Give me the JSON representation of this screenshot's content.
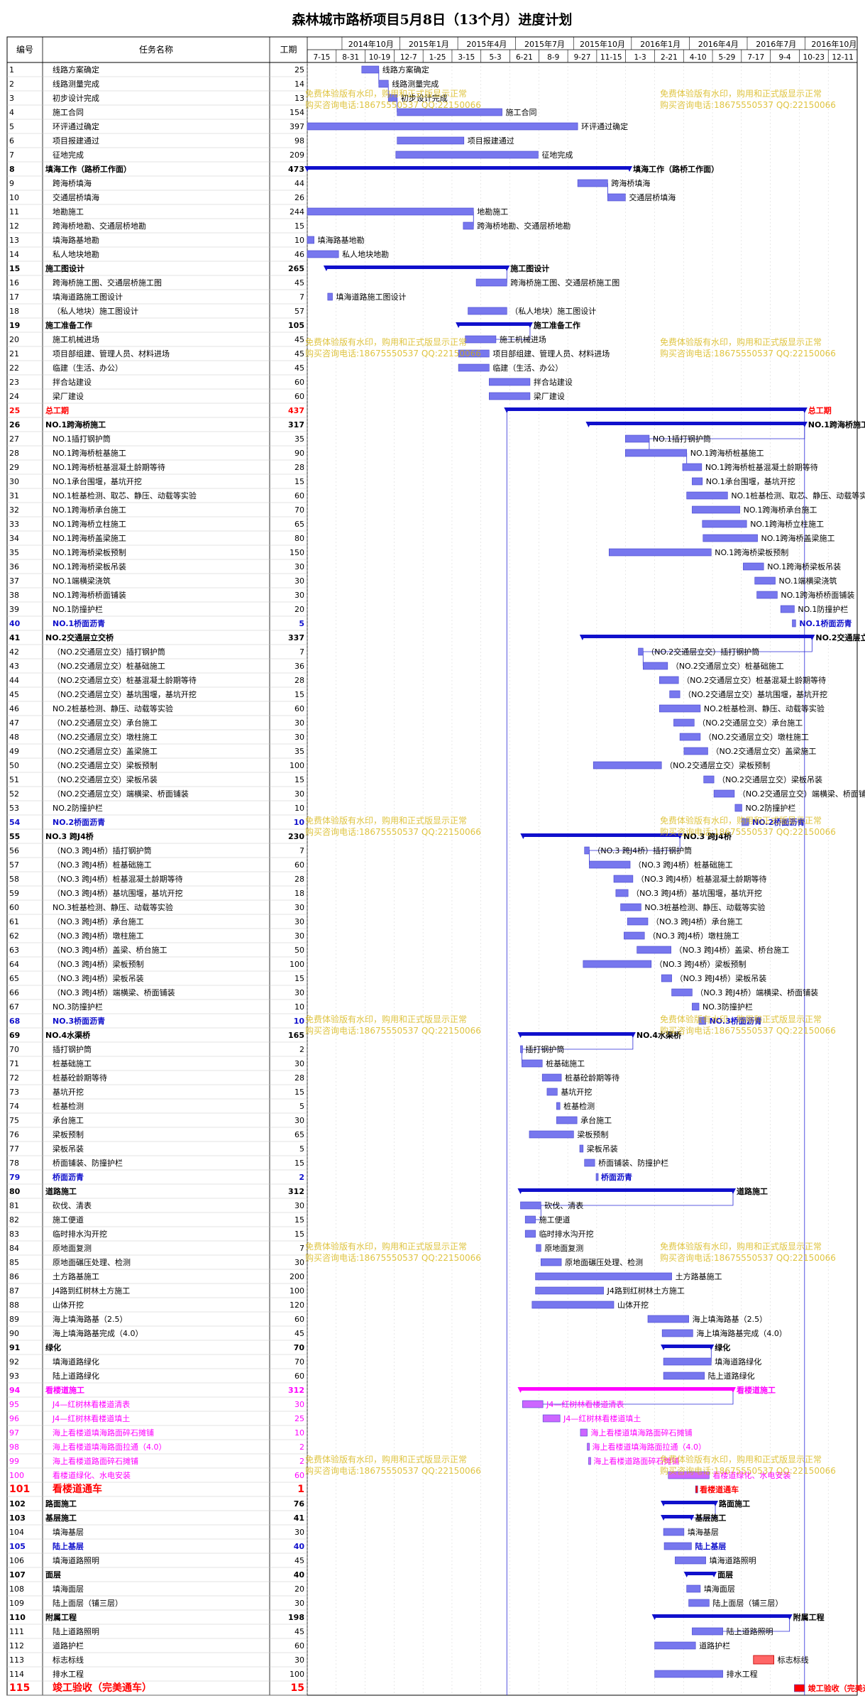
{
  "title": "森林城市路桥项目5月8日（13个月）进度计划",
  "columns": {
    "id": "编号",
    "name": "任务名称",
    "duration": "工期"
  },
  "timeline": {
    "top_labels": [
      "2014年10月",
      "2015年1月",
      "2015年4月",
      "2015年7月",
      "2015年10月",
      "2016年1月",
      "2016年4月",
      "2016年7月",
      "2016年10月"
    ],
    "bottom_labels": [
      "7-15",
      "8-31",
      "10-19",
      "12-7",
      "1-25",
      "3-15",
      "5-3",
      "6-21",
      "8-9",
      "9-27",
      "11-15",
      "1-3",
      "2-21",
      "4-10",
      "5-29",
      "7-17",
      "9-4",
      "10-23",
      "12-11"
    ]
  },
  "watermark": {
    "line1": "免费体验版有水印，购用和正式版显示正常",
    "line2": "购买咨询电话:18675550537  QQ:22150066"
  },
  "colors": {
    "bar": "#7777ee",
    "bar_dark": "#4444cc",
    "summary": "#1010cc",
    "link": "#2a2ad8",
    "red": "#ff0000",
    "magenta": "#ff00ff",
    "grid": "#c8c8c8"
  },
  "chart_data": {
    "type": "gantt",
    "x_unit": "days from 2014-07-15",
    "tasks": [
      {
        "id": "1",
        "name": "线路方案确定",
        "duration": 25,
        "start": 80,
        "kind": "task",
        "style": "normal"
      },
      {
        "id": "2",
        "name": "线路测量完成",
        "duration": 14,
        "start": 105,
        "kind": "task",
        "style": "normal"
      },
      {
        "id": "3",
        "name": "初步设计完成",
        "duration": 13,
        "start": 119,
        "kind": "task",
        "style": "normal"
      },
      {
        "id": "4",
        "name": "施工合同",
        "duration": 154,
        "start": 132,
        "kind": "task",
        "style": "normal"
      },
      {
        "id": "5",
        "name": "环评通过确定",
        "duration": 397,
        "start": 0,
        "kind": "task",
        "style": "normal"
      },
      {
        "id": "6",
        "name": "项目报建通过",
        "duration": 98,
        "start": 132,
        "kind": "task",
        "style": "normal"
      },
      {
        "id": "7",
        "name": "征地完成",
        "duration": 209,
        "start": 130,
        "kind": "task",
        "style": "normal"
      },
      {
        "id": "8",
        "name": "填海工作（路桥工作面）",
        "duration": 473,
        "start": 0,
        "kind": "summary",
        "style": "normal"
      },
      {
        "id": "9",
        "name": "跨海桥填海",
        "duration": 44,
        "start": 397,
        "kind": "task",
        "style": "normal"
      },
      {
        "id": "10",
        "name": "交通层桥填海",
        "duration": 26,
        "start": 441,
        "kind": "task",
        "style": "normal"
      },
      {
        "id": "11",
        "name": "地勘施工",
        "duration": 244,
        "start": 0,
        "kind": "task",
        "style": "normal"
      },
      {
        "id": "12",
        "name": "跨海桥地勘、交通层桥地勘",
        "duration": 15,
        "start": 229,
        "kind": "task",
        "style": "normal"
      },
      {
        "id": "13",
        "name": "填海路基地勘",
        "duration": 10,
        "start": 0,
        "kind": "task",
        "style": "normal"
      },
      {
        "id": "14",
        "name": "私人地块地勘",
        "duration": 46,
        "start": 0,
        "kind": "task",
        "style": "normal"
      },
      {
        "id": "15",
        "name": "施工图设计",
        "duration": 265,
        "start": 28,
        "kind": "summary",
        "style": "normal"
      },
      {
        "id": "16",
        "name": "跨海桥施工图、交通层桥施工图",
        "duration": 45,
        "start": 248,
        "kind": "task",
        "style": "normal"
      },
      {
        "id": "17",
        "name": "填海道路施工图设计",
        "duration": 7,
        "start": 30,
        "kind": "task",
        "style": "normal"
      },
      {
        "id": "18",
        "name": "（私人地块）施工图设计",
        "duration": 57,
        "start": 236,
        "kind": "task",
        "style": "normal"
      },
      {
        "id": "19",
        "name": "施工准备工作",
        "duration": 105,
        "start": 222,
        "kind": "summary",
        "style": "normal"
      },
      {
        "id": "20",
        "name": "施工机械进场",
        "duration": 45,
        "start": 232,
        "kind": "task",
        "style": "normal"
      },
      {
        "id": "21",
        "name": "项目部组建、管理人员、材料进场",
        "duration": 45,
        "start": 222,
        "kind": "task",
        "style": "normal"
      },
      {
        "id": "22",
        "name": "临建（生活、办公）",
        "duration": 45,
        "start": 222,
        "kind": "task",
        "style": "normal"
      },
      {
        "id": "23",
        "name": "拌合站建设",
        "duration": 60,
        "start": 267,
        "kind": "task",
        "style": "normal"
      },
      {
        "id": "24",
        "name": "梁厂建设",
        "duration": 60,
        "start": 267,
        "kind": "task",
        "style": "normal"
      },
      {
        "id": "25",
        "name": "总工期",
        "duration": 437,
        "start": 293,
        "kind": "summary",
        "style": "red"
      },
      {
        "id": "26",
        "name": "NO.1跨海桥施工",
        "duration": 317,
        "start": 413,
        "kind": "summary",
        "style": "normal"
      },
      {
        "id": "27",
        "name": "NO.1插打钢护筒",
        "duration": 35,
        "start": 467,
        "kind": "task",
        "style": "normal"
      },
      {
        "id": "28",
        "name": "NO.1跨海桥桩基施工",
        "duration": 90,
        "start": 467,
        "kind": "task",
        "style": "normal"
      },
      {
        "id": "29",
        "name": "NO.1跨海桥桩基混凝土龄期等待",
        "duration": 28,
        "start": 551,
        "kind": "task",
        "style": "normal"
      },
      {
        "id": "30",
        "name": "NO.1承台围堰，基坑开挖",
        "duration": 15,
        "start": 565,
        "kind": "task",
        "style": "normal"
      },
      {
        "id": "31",
        "name": "NO.1桩基检测、取芯、静压、动载等实验",
        "duration": 60,
        "start": 557,
        "kind": "task",
        "style": "normal"
      },
      {
        "id": "32",
        "name": "NO.1跨海桥承台施工",
        "duration": 70,
        "start": 565,
        "kind": "task",
        "style": "normal"
      },
      {
        "id": "33",
        "name": "NO.1跨海桥立柱施工",
        "duration": 65,
        "start": 580,
        "kind": "task",
        "style": "normal"
      },
      {
        "id": "34",
        "name": "NO.1跨海桥盖梁施工",
        "duration": 80,
        "start": 581,
        "kind": "task",
        "style": "normal"
      },
      {
        "id": "35",
        "name": "NO.1跨海桥梁板预制",
        "duration": 150,
        "start": 443,
        "kind": "task",
        "style": "normal"
      },
      {
        "id": "36",
        "name": "NO.1跨海桥梁板吊装",
        "duration": 30,
        "start": 640,
        "kind": "task",
        "style": "normal"
      },
      {
        "id": "37",
        "name": "NO.1端横梁浇筑",
        "duration": 30,
        "start": 657,
        "kind": "task",
        "style": "normal"
      },
      {
        "id": "38",
        "name": "NO.1跨海桥桥面铺装",
        "duration": 30,
        "start": 660,
        "kind": "task",
        "style": "normal"
      },
      {
        "id": "39",
        "name": "NO.1防撞护栏",
        "duration": 20,
        "start": 695,
        "kind": "task",
        "style": "normal"
      },
      {
        "id": "40",
        "name": "NO.1桥面沥青",
        "duration": 5,
        "start": 712,
        "kind": "task",
        "style": "blue"
      },
      {
        "id": "41",
        "name": "NO.2交通层立交桥",
        "duration": 337,
        "start": 404,
        "kind": "summary",
        "style": "normal"
      },
      {
        "id": "42",
        "name": "（NO.2交通层立交）插打钢护筒",
        "duration": 7,
        "start": 486,
        "kind": "task",
        "style": "normal"
      },
      {
        "id": "43",
        "name": "（NO.2交通层立交）桩基础施工",
        "duration": 36,
        "start": 493,
        "kind": "task",
        "style": "normal"
      },
      {
        "id": "44",
        "name": "（NO.2交通层立交）桩基混凝土龄期等待",
        "duration": 28,
        "start": 517,
        "kind": "task",
        "style": "normal"
      },
      {
        "id": "45",
        "name": "（NO.2交通层立交）基坑围堰，基坑开挖",
        "duration": 15,
        "start": 532,
        "kind": "task",
        "style": "normal"
      },
      {
        "id": "46",
        "name": "NO.2桩基检测、静压、动载等实验",
        "duration": 60,
        "start": 517,
        "kind": "task",
        "style": "normal"
      },
      {
        "id": "47",
        "name": "（NO.2交通层立交）承台施工",
        "duration": 30,
        "start": 538,
        "kind": "task",
        "style": "normal"
      },
      {
        "id": "48",
        "name": "（NO.2交通层立交）墩柱施工",
        "duration": 30,
        "start": 547,
        "kind": "task",
        "style": "normal"
      },
      {
        "id": "49",
        "name": "（NO.2交通层立交）盖梁施工",
        "duration": 35,
        "start": 553,
        "kind": "task",
        "style": "normal"
      },
      {
        "id": "50",
        "name": "（NO.2交通层立交）梁板预制",
        "duration": 100,
        "start": 420,
        "kind": "task",
        "style": "normal"
      },
      {
        "id": "51",
        "name": "（NO.2交通层立交）梁板吊装",
        "duration": 15,
        "start": 582,
        "kind": "task",
        "style": "normal"
      },
      {
        "id": "52",
        "name": "（NO.2交通层立交）端横梁、桥面铺装",
        "duration": 30,
        "start": 597,
        "kind": "task",
        "style": "normal"
      },
      {
        "id": "53",
        "name": "NO.2防撞护栏",
        "duration": 10,
        "start": 628,
        "kind": "task",
        "style": "normal"
      },
      {
        "id": "54",
        "name": "NO.2桥面沥青",
        "duration": 10,
        "start": 638,
        "kind": "task",
        "style": "blue"
      },
      {
        "id": "55",
        "name": "NO.3 跨J4桥",
        "duration": 230,
        "start": 317,
        "kind": "summary",
        "style": "normal"
      },
      {
        "id": "56",
        "name": "（NO.3 跨J4桥）插打钢护筒",
        "duration": 7,
        "start": 407,
        "kind": "task",
        "style": "normal"
      },
      {
        "id": "57",
        "name": "（NO.3 跨J4桥）桩基础施工",
        "duration": 60,
        "start": 414,
        "kind": "task",
        "style": "normal"
      },
      {
        "id": "58",
        "name": "（NO.3 跨J4桥）桩基混凝土龄期等待",
        "duration": 28,
        "start": 450,
        "kind": "task",
        "style": "normal"
      },
      {
        "id": "59",
        "name": "（NO.3 跨J4桥）基坑围堰，基坑开挖",
        "duration": 18,
        "start": 453,
        "kind": "task",
        "style": "normal"
      },
      {
        "id": "60",
        "name": "NO.3桩基检测、静压、动载等实验",
        "duration": 30,
        "start": 460,
        "kind": "task",
        "style": "normal"
      },
      {
        "id": "61",
        "name": "（NO.3 跨J4桥）承台施工",
        "duration": 30,
        "start": 470,
        "kind": "task",
        "style": "normal"
      },
      {
        "id": "62",
        "name": "（NO.3 跨J4桥）墩柱施工",
        "duration": 30,
        "start": 465,
        "kind": "task",
        "style": "normal"
      },
      {
        "id": "63",
        "name": "（NO.3 跨J4桥）盖梁、桥台施工",
        "duration": 50,
        "start": 484,
        "kind": "task",
        "style": "normal"
      },
      {
        "id": "64",
        "name": "（NO.3 跨J4桥）梁板预制",
        "duration": 100,
        "start": 405,
        "kind": "task",
        "style": "normal"
      },
      {
        "id": "65",
        "name": "（NO.3 跨J4桥）梁板吊装",
        "duration": 15,
        "start": 520,
        "kind": "task",
        "style": "normal"
      },
      {
        "id": "66",
        "name": "（NO.3 跨J4桥）端横梁、桥面铺装",
        "duration": 30,
        "start": 535,
        "kind": "task",
        "style": "normal"
      },
      {
        "id": "67",
        "name": "NO.3防撞护栏",
        "duration": 10,
        "start": 565,
        "kind": "task",
        "style": "normal"
      },
      {
        "id": "68",
        "name": "NO.3桥面沥青",
        "duration": 10,
        "start": 575,
        "kind": "task",
        "style": "blue"
      },
      {
        "id": "69",
        "name": "NO.4水渠桥",
        "duration": 165,
        "start": 313,
        "kind": "summary",
        "style": "normal"
      },
      {
        "id": "70",
        "name": "插打钢护筒",
        "duration": 2,
        "start": 313,
        "kind": "task",
        "style": "normal"
      },
      {
        "id": "71",
        "name": "桩基础施工",
        "duration": 30,
        "start": 315,
        "kind": "task",
        "style": "normal"
      },
      {
        "id": "72",
        "name": "桩基砼龄期等待",
        "duration": 28,
        "start": 345,
        "kind": "task",
        "style": "normal"
      },
      {
        "id": "73",
        "name": "基坑开挖",
        "duration": 15,
        "start": 352,
        "kind": "task",
        "style": "normal"
      },
      {
        "id": "74",
        "name": "桩基检测",
        "duration": 5,
        "start": 366,
        "kind": "task",
        "style": "normal"
      },
      {
        "id": "75",
        "name": "承台施工",
        "duration": 30,
        "start": 366,
        "kind": "task",
        "style": "normal"
      },
      {
        "id": "76",
        "name": "梁板预制",
        "duration": 65,
        "start": 326,
        "kind": "task",
        "style": "normal"
      },
      {
        "id": "77",
        "name": "梁板吊装",
        "duration": 5,
        "start": 400,
        "kind": "task",
        "style": "normal"
      },
      {
        "id": "78",
        "name": "桥面铺装、防撞护栏",
        "duration": 15,
        "start": 407,
        "kind": "task",
        "style": "normal"
      },
      {
        "id": "79",
        "name": "桥面沥青",
        "duration": 2,
        "start": 424,
        "kind": "task",
        "style": "blue"
      },
      {
        "id": "80",
        "name": "道路施工",
        "duration": 312,
        "start": 313,
        "kind": "summary",
        "style": "normal"
      },
      {
        "id": "81",
        "name": "砍伐、清表",
        "duration": 30,
        "start": 313,
        "kind": "task",
        "style": "normal"
      },
      {
        "id": "82",
        "name": "施工便道",
        "duration": 15,
        "start": 320,
        "kind": "task",
        "style": "normal"
      },
      {
        "id": "83",
        "name": "临时排水沟开挖",
        "duration": 15,
        "start": 320,
        "kind": "task",
        "style": "normal"
      },
      {
        "id": "84",
        "name": "原地面复测",
        "duration": 7,
        "start": 336,
        "kind": "task",
        "style": "normal"
      },
      {
        "id": "85",
        "name": "原地面碾压处理、检测",
        "duration": 30,
        "start": 343,
        "kind": "task",
        "style": "normal"
      },
      {
        "id": "86",
        "name": "土方路基施工",
        "duration": 200,
        "start": 335,
        "kind": "task",
        "style": "normal"
      },
      {
        "id": "87",
        "name": "J4路到红树林土方施工",
        "duration": 100,
        "start": 335,
        "kind": "task",
        "style": "normal"
      },
      {
        "id": "88",
        "name": "山体开挖",
        "duration": 120,
        "start": 330,
        "kind": "task",
        "style": "normal"
      },
      {
        "id": "89",
        "name": "海上填海路基（2.5）",
        "duration": 60,
        "start": 500,
        "kind": "task",
        "style": "normal"
      },
      {
        "id": "90",
        "name": "海上填海路基完成（4.0）",
        "duration": 45,
        "start": 521,
        "kind": "task",
        "style": "normal"
      },
      {
        "id": "91",
        "name": "绿化",
        "duration": 70,
        "start": 523,
        "kind": "summary",
        "style": "normal"
      },
      {
        "id": "92",
        "name": "填海道路绿化",
        "duration": 70,
        "start": 523,
        "kind": "task",
        "style": "normal"
      },
      {
        "id": "93",
        "name": "陆上道路绿化",
        "duration": 60,
        "start": 523,
        "kind": "task",
        "style": "normal"
      },
      {
        "id": "94",
        "name": "看楼道施工",
        "duration": 312,
        "start": 313,
        "kind": "summary",
        "style": "magenta"
      },
      {
        "id": "95",
        "name": "J4—红树林看楼道清表",
        "duration": 30,
        "start": 316,
        "kind": "task",
        "style": "magenta"
      },
      {
        "id": "96",
        "name": "J4—红树林看楼道填土",
        "duration": 25,
        "start": 346,
        "kind": "task",
        "style": "magenta"
      },
      {
        "id": "97",
        "name": "海上看楼道填海路面碎石摊铺",
        "duration": 10,
        "start": 401,
        "kind": "task",
        "style": "magenta"
      },
      {
        "id": "98",
        "name": "海上看楼道填海路面拉通（4.0）",
        "duration": 2,
        "start": 411,
        "kind": "task",
        "style": "magenta"
      },
      {
        "id": "99",
        "name": "海上看楼道路面碎石摊铺",
        "duration": 2,
        "start": 413,
        "kind": "task",
        "style": "magenta"
      },
      {
        "id": "100",
        "name": "看楼道绿化、水电安装",
        "duration": 60,
        "start": 530,
        "kind": "task",
        "style": "magenta"
      },
      {
        "id": "101",
        "name": "看楼道通车",
        "duration": 1,
        "start": 570,
        "kind": "task",
        "style": "red"
      },
      {
        "id": "102",
        "name": "路面施工",
        "duration": 76,
        "start": 523,
        "kind": "summary",
        "style": "normal"
      },
      {
        "id": "103",
        "name": "基层施工",
        "duration": 41,
        "start": 523,
        "kind": "summary",
        "style": "normal"
      },
      {
        "id": "104",
        "name": "填海基层",
        "duration": 30,
        "start": 523,
        "kind": "task",
        "style": "normal"
      },
      {
        "id": "105",
        "name": "陆上基层",
        "duration": 40,
        "start": 524,
        "kind": "task",
        "style": "blue"
      },
      {
        "id": "106",
        "name": "填海道路照明",
        "duration": 45,
        "start": 540,
        "kind": "task",
        "style": "normal"
      },
      {
        "id": "107",
        "name": "面层",
        "duration": 40,
        "start": 557,
        "kind": "summary",
        "style": "normal"
      },
      {
        "id": "108",
        "name": "填海面层",
        "duration": 20,
        "start": 557,
        "kind": "task",
        "style": "normal"
      },
      {
        "id": "109",
        "name": "陆上面层（铺三层）",
        "duration": 30,
        "start": 560,
        "kind": "task",
        "style": "normal"
      },
      {
        "id": "110",
        "name": "附属工程",
        "duration": 198,
        "start": 510,
        "kind": "summary",
        "style": "normal"
      },
      {
        "id": "111",
        "name": "陆上道路照明",
        "duration": 45,
        "start": 565,
        "kind": "task",
        "style": "normal"
      },
      {
        "id": "112",
        "name": "道路护栏",
        "duration": 60,
        "start": 510,
        "kind": "task",
        "style": "normal"
      },
      {
        "id": "113",
        "name": "标志标线",
        "duration": 30,
        "start": 655,
        "kind": "task",
        "style": "milestone-red"
      },
      {
        "id": "114",
        "name": "排水工程",
        "duration": 100,
        "start": 510,
        "kind": "task",
        "style": "normal"
      },
      {
        "id": "115",
        "name": "竣工验收（完美通车）",
        "duration": 15,
        "start": 715,
        "kind": "task",
        "style": "red"
      }
    ]
  }
}
